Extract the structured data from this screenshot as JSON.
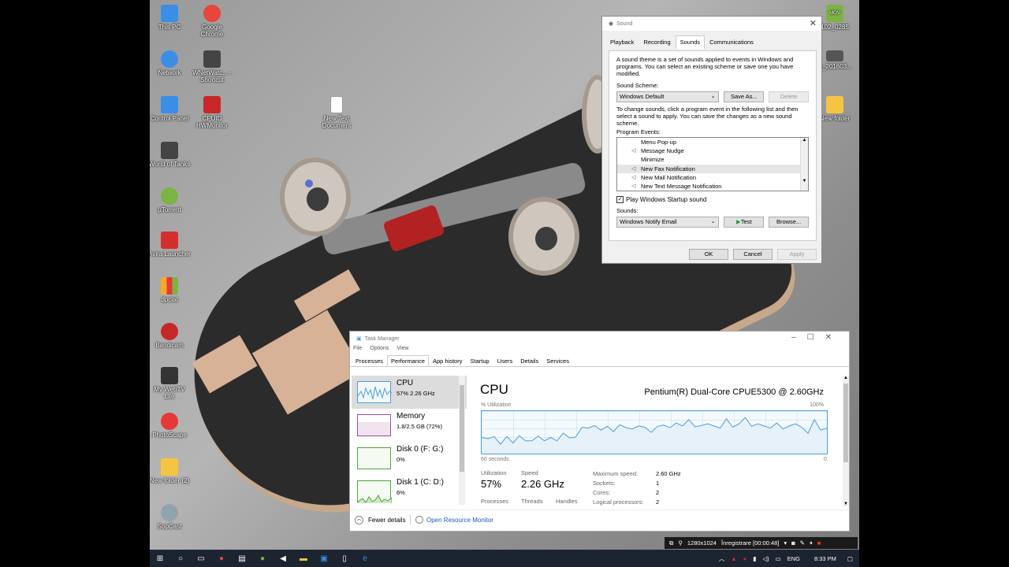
{
  "desktop": {
    "icons": [
      {
        "label": "This PC",
        "icon": "monitor-icon",
        "color": "#3a8ee6"
      },
      {
        "label": "Google Chrome",
        "icon": "chrome-icon",
        "color": "#e8453c"
      },
      {
        "label": "Network",
        "icon": "network-icon",
        "color": "#3a8ee6"
      },
      {
        "label": "WNetWatc... - Shortcut",
        "icon": "eye-icon",
        "color": "#444444"
      },
      {
        "label": "Control Panel",
        "icon": "control-panel-icon",
        "color": "#3a8ee6"
      },
      {
        "label": "CPUID HWMonitor",
        "icon": "hwmonitor-icon",
        "color": "#c62828"
      },
      {
        "label": "New Text Document",
        "icon": "text-file-icon",
        "color": "#ffffff"
      },
      {
        "label": "World of Tanks",
        "icon": "tanks-icon",
        "color": "#444444"
      },
      {
        "label": "µTorrent",
        "icon": "utorrent-icon",
        "color": "#7cb342"
      },
      {
        "label": "Avira Launcher",
        "icon": "avira-icon",
        "color": "#d32f2f"
      },
      {
        "label": "dpclat",
        "icon": "bars-icon",
        "color": "#f9a825"
      },
      {
        "label": "Bandicam",
        "icon": "bandicam-icon",
        "color": "#c62828"
      },
      {
        "label": "My WebTV Lite",
        "icon": "tv-icon",
        "color": "#333333"
      },
      {
        "label": "PhotoScape",
        "icon": "photoscape-icon",
        "color": "#e53935"
      },
      {
        "label": "New folder (2)",
        "icon": "folder-icon",
        "color": "#f5c542"
      },
      {
        "label": "SopCast",
        "icon": "sopcast-icon",
        "color": "#90a4ae"
      },
      {
        "label": "102_0285",
        "icon": "video-file-icon",
        "color": "#7cb342",
        "badge": "MOV"
      },
      {
        "label": "D_201603...",
        "icon": "image-file-icon",
        "color": "#555555"
      },
      {
        "label": "New folder",
        "icon": "folder-icon",
        "color": "#f5c542"
      }
    ]
  },
  "sound": {
    "title": "Sound",
    "tabs": [
      "Playback",
      "Recording",
      "Sounds",
      "Communications"
    ],
    "active_tab": "Sounds",
    "intro": "A sound theme is a set of sounds applied to events in Windows and programs.  You can select an existing scheme or save one you have modified.",
    "scheme_label": "Sound Scheme:",
    "scheme_value": "Windows Default",
    "save_as": "Save As...",
    "delete": "Delete",
    "change_text": "To change sounds, click a program event in the following list and then select a sound to apply.  You can save the changes as a new sound scheme.",
    "events_label": "Program Events:",
    "events": [
      {
        "name": "Menu Pop-up",
        "has_sound": false,
        "selected": false
      },
      {
        "name": "Message Nudge",
        "has_sound": true,
        "selected": false
      },
      {
        "name": "Minimize",
        "has_sound": false,
        "selected": false
      },
      {
        "name": "New Fax Notification",
        "has_sound": true,
        "selected": true
      },
      {
        "name": "New Mail Notification",
        "has_sound": true,
        "selected": false
      },
      {
        "name": "New Text Message Notification",
        "has_sound": true,
        "selected": false
      }
    ],
    "startup_checkbox": "Play Windows Startup sound",
    "startup_checked": true,
    "sounds_label": "Sounds:",
    "sound_value": "Windows Notify Email",
    "test": "Test",
    "browse": "Browse...",
    "ok": "OK",
    "cancel": "Cancel",
    "apply": "Apply"
  },
  "taskmgr": {
    "title": "Task Manager",
    "menu": [
      "File",
      "Options",
      "View"
    ],
    "tabs": [
      "Processes",
      "Performance",
      "App history",
      "Startup",
      "Users",
      "Details",
      "Services"
    ],
    "active_tab": "Performance",
    "side": [
      {
        "name": "CPU",
        "value": "57%  2.26 GHz",
        "selected": true,
        "color": "#4d9dd8"
      },
      {
        "name": "Memory",
        "value": "1.8/2.5 GB (72%)",
        "selected": false,
        "color": "#9b4f96"
      },
      {
        "name": "Disk 0 (F: G:)",
        "value": "0%",
        "selected": false,
        "color": "#4da33a"
      },
      {
        "name": "Disk 1 (C: D:)",
        "value": "6%",
        "selected": false,
        "color": "#4da33a"
      }
    ],
    "main_title": "CPU",
    "cpu_model": "Pentium(R) Dual-Core CPUE5300 @ 2.60GHz",
    "util_label": "% Utilization",
    "util_max": "100%",
    "time_label": "60 seconds",
    "time_min": "0",
    "cpu_history": [
      38,
      35,
      40,
      22,
      40,
      25,
      42,
      30,
      30,
      41,
      30,
      38,
      30,
      48,
      37,
      39,
      62,
      60,
      66,
      55,
      64,
      52,
      68,
      61,
      58,
      65,
      62,
      50,
      64,
      67,
      61,
      72,
      65,
      80,
      63,
      66,
      70,
      65,
      60,
      82,
      62,
      70,
      85,
      64,
      70,
      65,
      60,
      72,
      58,
      65,
      70,
      62,
      48,
      80,
      55,
      60
    ],
    "utilization_label": "Utilization",
    "utilization": "57%",
    "speed_label": "Speed",
    "speed": "2.26 GHz",
    "processes_label": "Processes",
    "threads_label": "Threads",
    "handles_label": "Handles",
    "specs": [
      {
        "k": "Maximum speed:",
        "v": "2.60 GHz"
      },
      {
        "k": "Sockets:",
        "v": "1"
      },
      {
        "k": "Cores:",
        "v": "2"
      },
      {
        "k": "Logical processors:",
        "v": "2"
      }
    ],
    "fewer_details": "Fewer details",
    "open_resmon": "Open Resource Monitor"
  },
  "recorder": {
    "resolution": "1280x1024",
    "status": "Înregistrare [00:00:48]"
  },
  "taskbar": {
    "lang": "ENG",
    "time": "8:33 PM"
  }
}
